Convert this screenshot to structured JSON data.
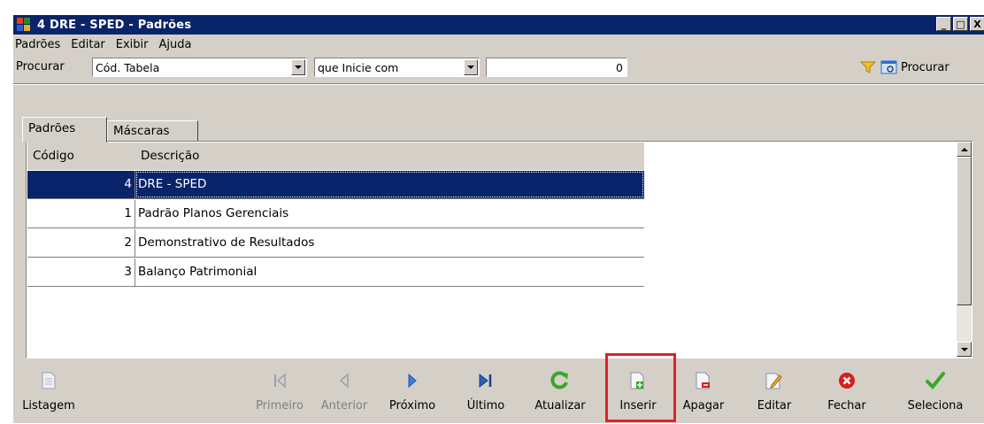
{
  "window": {
    "title": "4 DRE - SPED - Padrões",
    "controls": [
      "_",
      "□",
      "X"
    ]
  },
  "menu": [
    "Padrões",
    "Editar",
    "Exibir",
    "Ajuda"
  ],
  "search": {
    "label": "Procurar",
    "field_value": "Cód. Tabela",
    "condition_value": "que Inicie com",
    "input_value": "0",
    "button_label": "Procurar"
  },
  "tabs": [
    "Padrões",
    "Máscaras"
  ],
  "table": {
    "columns": [
      "Código",
      "Descrição"
    ],
    "rows": [
      {
        "code": "4",
        "desc": "DRE - SPED"
      },
      {
        "code": "1",
        "desc": "Padrão Planos Gerenciais"
      },
      {
        "code": "2",
        "desc": "Demonstrativo de Resultados"
      },
      {
        "code": "3",
        "desc": "Balanço Patrimonial"
      }
    ]
  },
  "toolbar": {
    "listagem": "Listagem",
    "primeiro": "Primeiro",
    "anterior": "Anterior",
    "proximo": "Próximo",
    "ultimo": "Último",
    "atualizar": "Atualizar",
    "inserir": "Inserir",
    "apagar": "Apagar",
    "editar": "Editar",
    "fechar": "Fechar",
    "seleciona": "Seleciona"
  },
  "colors": {
    "title_bg": "#0a246a",
    "face": "#d4d0c8",
    "highlight": "#e0202a",
    "green": "#3aa629",
    "red": "#d81e1e",
    "blue": "#2a6fd4"
  }
}
